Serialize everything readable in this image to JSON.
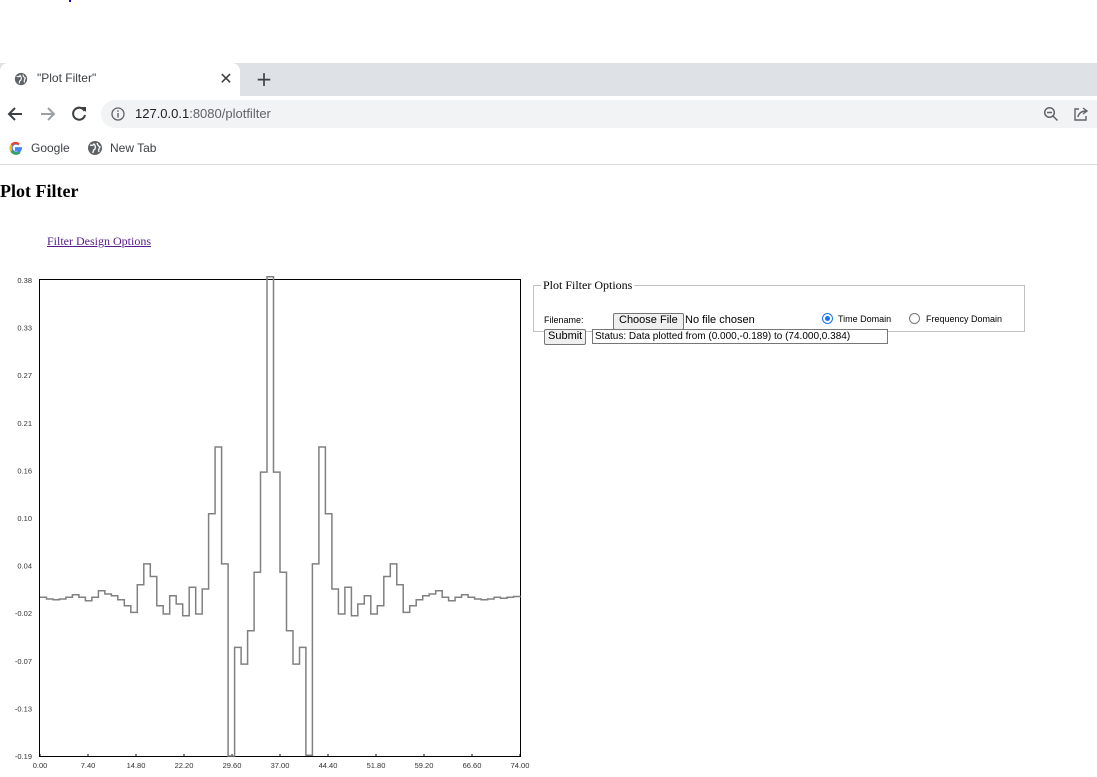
{
  "browser": {
    "tab_title": "\"Plot Filter\"",
    "url_host": "127.0.0.1",
    "url_path": ":8080/plotfilter",
    "close_glyph": "✕",
    "new_tab_glyph": "+",
    "bookmarks": [
      {
        "label": "Google",
        "icon": "google-icon"
      },
      {
        "label": "New Tab",
        "icon": "globe-icon"
      }
    ],
    "icons": [
      "back-icon",
      "forward-icon",
      "reload-icon",
      "info-icon",
      "zoom-out-icon",
      "share-icon"
    ]
  },
  "page": {
    "title": "Plot Filter",
    "link_text": "Filter Design Options"
  },
  "options": {
    "legend": "Plot Filter Options",
    "filename_label": "Filename:",
    "choose_file_label": "Choose File",
    "no_file_text": "No file chosen",
    "time_domain_label": "Time Domain",
    "frequency_domain_label": "Frequency Domain",
    "selected_domain": "Time Domain",
    "submit_label": "Submit",
    "status_value": "Status: Data plotted from (0.000,-0.189) to (74.000,0.384)"
  },
  "colors": {
    "plot_line": "#808080",
    "link": "#551a8b",
    "radio_accent": "#1a73e8"
  },
  "chart_data": {
    "type": "line",
    "step": true,
    "title": "",
    "xlabel": "",
    "ylabel": "",
    "xlim": [
      0,
      74
    ],
    "ylim": [
      -0.19,
      0.38
    ],
    "x_ticks": [
      "0.00",
      "7.40",
      "14.80",
      "22.20",
      "29.60",
      "37.00",
      "44.40",
      "51.80",
      "59.20",
      "66.60",
      "74.00"
    ],
    "y_ticks": [
      "0.38",
      "0.33",
      "0.27",
      "0.21",
      "0.16",
      "0.10",
      "0.04",
      "-0.02",
      "-0.07",
      "-0.13",
      "-0.19"
    ],
    "series": [
      {
        "x": [
          0,
          1,
          2,
          3,
          4,
          5,
          6,
          7,
          8,
          9,
          10,
          11,
          12,
          13,
          14,
          15,
          16,
          17,
          18,
          19,
          20,
          21,
          22,
          23,
          24,
          25,
          26,
          27,
          28,
          29,
          30,
          31,
          32,
          33,
          34,
          35,
          36,
          37,
          38,
          39,
          40,
          41,
          42,
          43,
          44,
          45,
          46,
          47,
          48,
          49,
          50,
          51,
          52,
          53,
          54,
          55,
          56,
          57,
          58,
          59,
          60,
          61,
          62,
          63,
          64,
          65,
          66,
          67,
          68,
          69,
          70,
          71,
          72,
          73,
          74
        ],
        "y": [
          0.0,
          -0.002,
          -0.003,
          -0.002,
          0.0,
          0.003,
          0.0,
          -0.004,
          0.0,
          0.008,
          0.004,
          0.002,
          -0.003,
          -0.01,
          -0.018,
          0.015,
          0.04,
          0.025,
          -0.01,
          -0.02,
          0.002,
          -0.008,
          -0.022,
          0.012,
          -0.02,
          0.01,
          0.1,
          0.18,
          0.04,
          -0.19,
          -0.06,
          -0.08,
          -0.04,
          0.03,
          0.15,
          0.384,
          0.15,
          0.03,
          -0.04,
          -0.08,
          -0.06,
          -0.189,
          0.04,
          0.18,
          0.1,
          0.01,
          -0.02,
          0.012,
          -0.022,
          -0.008,
          0.002,
          -0.02,
          -0.01,
          0.025,
          0.04,
          0.015,
          -0.018,
          -0.01,
          -0.003,
          0.002,
          0.004,
          0.008,
          0.0,
          -0.004,
          0.0,
          0.003,
          0.0,
          -0.002,
          -0.003,
          -0.002,
          0.0,
          -0.001,
          0.0,
          0.001,
          0.0
        ]
      }
    ]
  }
}
